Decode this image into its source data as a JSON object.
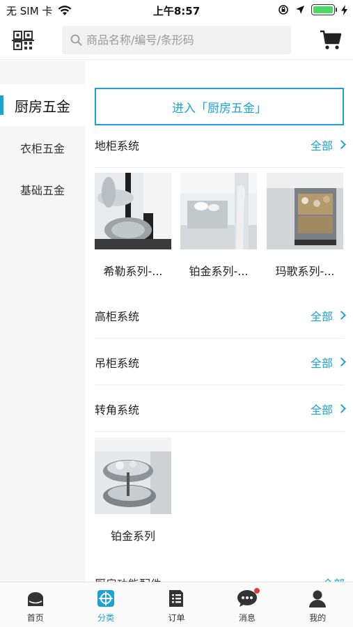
{
  "status_bar": {
    "carrier": "无 SIM 卡",
    "time": "上午8:57"
  },
  "header": {
    "search_placeholder": "商品名称/编号/条形码"
  },
  "sidebar": {
    "items": [
      {
        "label": "厨房五金",
        "active": true
      },
      {
        "label": "衣柜五金",
        "active": false
      },
      {
        "label": "基础五金",
        "active": false
      }
    ]
  },
  "main": {
    "enter_label": "进入「厨房五金」",
    "sections": [
      {
        "title": "地柜系统",
        "all_label": "全部",
        "products": [
          {
            "name": "希勒系列-..."
          },
          {
            "name": "铂金系列-..."
          },
          {
            "name": "玛歌系列-..."
          }
        ]
      },
      {
        "title": "高柜系统",
        "all_label": "全部",
        "products": []
      },
      {
        "title": "吊柜系统",
        "all_label": "全部",
        "products": []
      },
      {
        "title": "转角系统",
        "all_label": "全部",
        "products": [
          {
            "name": "铂金系列"
          }
        ]
      }
    ],
    "partial_section": {
      "title": "厨房功能配件",
      "all_label": "全部"
    }
  },
  "tab_bar": {
    "items": [
      {
        "label": "首页",
        "icon": "home-icon",
        "active": false
      },
      {
        "label": "分类",
        "icon": "category-icon",
        "active": true
      },
      {
        "label": "订单",
        "icon": "order-icon",
        "active": false
      },
      {
        "label": "消息",
        "icon": "message-icon",
        "active": false,
        "badge": true
      },
      {
        "label": "我的",
        "icon": "profile-icon",
        "active": false
      }
    ]
  },
  "colors": {
    "accent": "#1aa3d4",
    "badge": "#e8373b",
    "battery": "#4cd964"
  }
}
